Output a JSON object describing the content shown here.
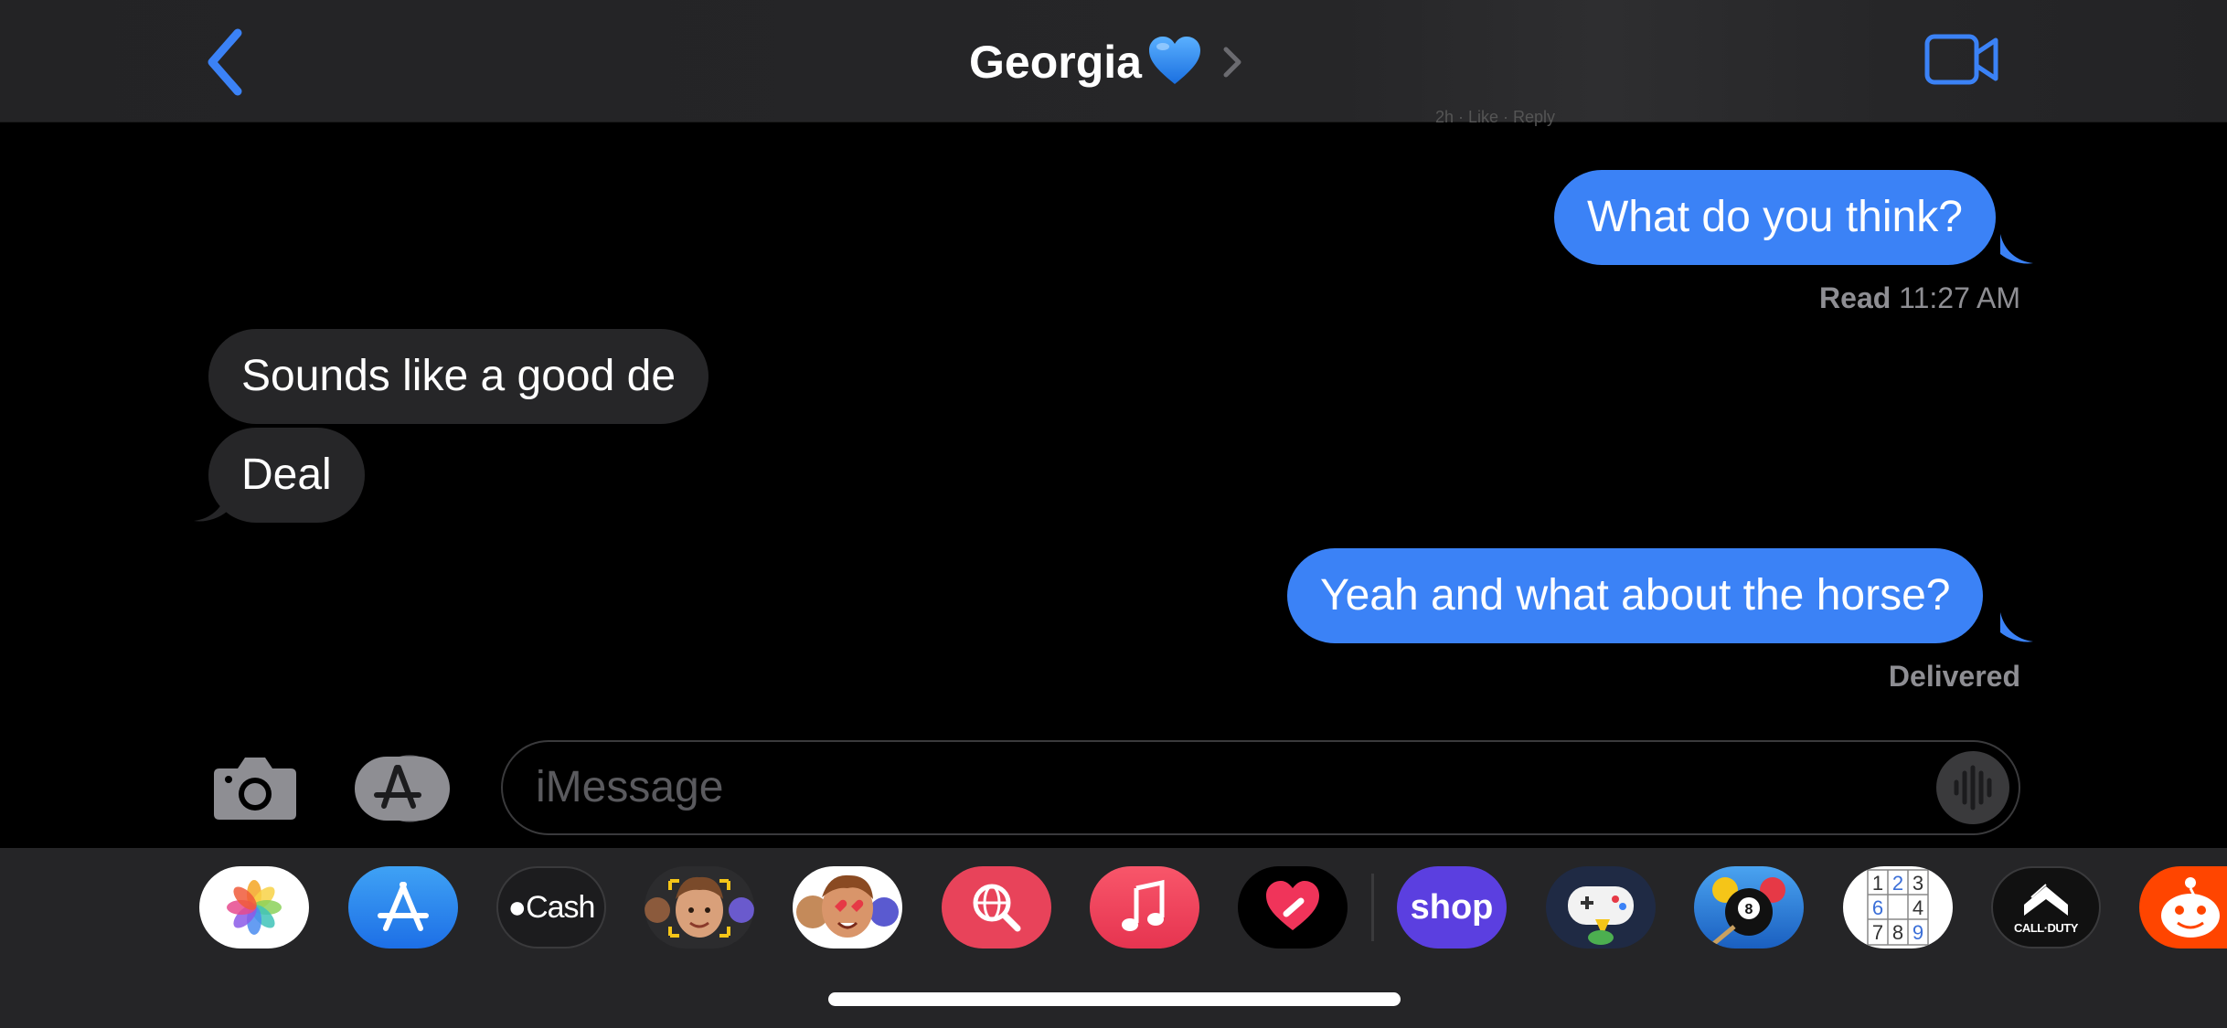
{
  "header": {
    "contact_name": "Georgia",
    "contact_emoji": "💙",
    "peek_text": "2h · Like · Reply"
  },
  "messages": [
    {
      "direction": "outgoing",
      "text": "What do you think?"
    },
    {
      "direction": "status",
      "read_label": "Read",
      "read_time": "11:27 AM"
    },
    {
      "direction": "incoming",
      "text": "Sounds like a good de"
    },
    {
      "direction": "incoming",
      "text": "Deal"
    },
    {
      "direction": "outgoing",
      "text": "Yeah and what about the horse?"
    },
    {
      "direction": "status",
      "text": "Delivered"
    }
  ],
  "composer": {
    "placeholder": "iMessage"
  },
  "app_drawer": {
    "apps": [
      {
        "name": "photos-app",
        "icon": "photos-icon"
      },
      {
        "name": "app-store-app",
        "icon": "app-store-icon"
      },
      {
        "name": "apple-cash-app",
        "label": "Cash"
      },
      {
        "name": "memoji-app",
        "icon": "memoji-icon"
      },
      {
        "name": "animoji-stickers-app",
        "icon": "animoji-icon"
      },
      {
        "name": "web-search-app",
        "icon": "globe-search-icon"
      },
      {
        "name": "music-app",
        "icon": "music-note-icon"
      },
      {
        "name": "digital-touch-app",
        "icon": "heart-icon"
      },
      {
        "name": "shop-app",
        "label": "shop"
      },
      {
        "name": "game-pigeon-app",
        "icon": "game-controller-icon"
      },
      {
        "name": "8-ball-pool-app",
        "icon": "8-ball-icon"
      },
      {
        "name": "sudoku-app",
        "grid": [
          "1",
          "2",
          "3",
          "6",
          "",
          "4",
          "7",
          "8",
          "9"
        ]
      },
      {
        "name": "call-of-duty-app",
        "label": "CALL·DUTY"
      },
      {
        "name": "reddit-app",
        "icon": "reddit-icon"
      }
    ]
  },
  "colors": {
    "accent": "#3B82F6",
    "incoming_bubble": "#262628",
    "header_bg": "#232325",
    "drawer_bg": "#252527"
  }
}
